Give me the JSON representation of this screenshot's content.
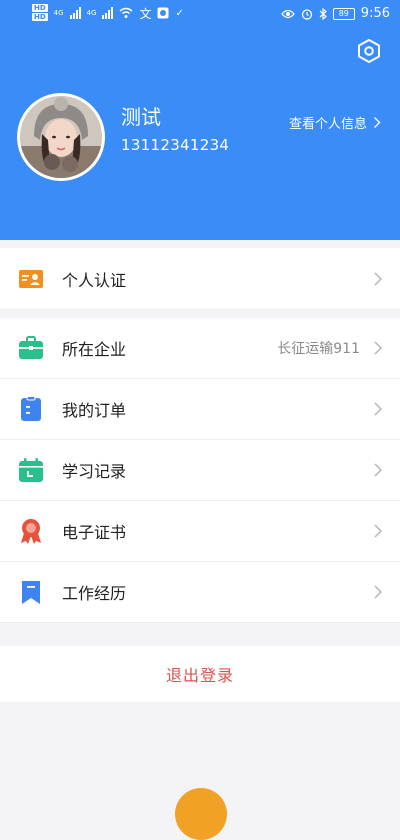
{
  "status_bar": {
    "hd_badges": [
      "HD",
      "HD"
    ],
    "network_1": "4G",
    "network_2": "4G",
    "battery": "89",
    "time": "9:56"
  },
  "profile": {
    "name": "测试",
    "phone": "13112341234",
    "view_profile_label": "查看个人信息"
  },
  "menu": [
    {
      "label": "个人认证",
      "value": "",
      "icon": "id-card-icon",
      "color": "#f0901e"
    },
    {
      "label": "所在企业",
      "value": "长征运输911",
      "icon": "briefcase-icon",
      "color": "#2bbf8a"
    },
    {
      "label": "我的订单",
      "value": "",
      "icon": "order-clipboard-icon",
      "color": "#3e83f0"
    },
    {
      "label": "学习记录",
      "value": "",
      "icon": "calendar-icon",
      "color": "#2bbf8a"
    },
    {
      "label": "电子证书",
      "value": "",
      "icon": "medal-icon",
      "color": "#e5533d"
    },
    {
      "label": "工作经历",
      "value": "",
      "icon": "bookmark-icon",
      "color": "#3e83f0"
    }
  ],
  "logout_label": "退出登录",
  "colors": {
    "header_blue": "#3a8cf7",
    "logout_red": "#d9534f",
    "fab_orange": "#f2a127"
  }
}
